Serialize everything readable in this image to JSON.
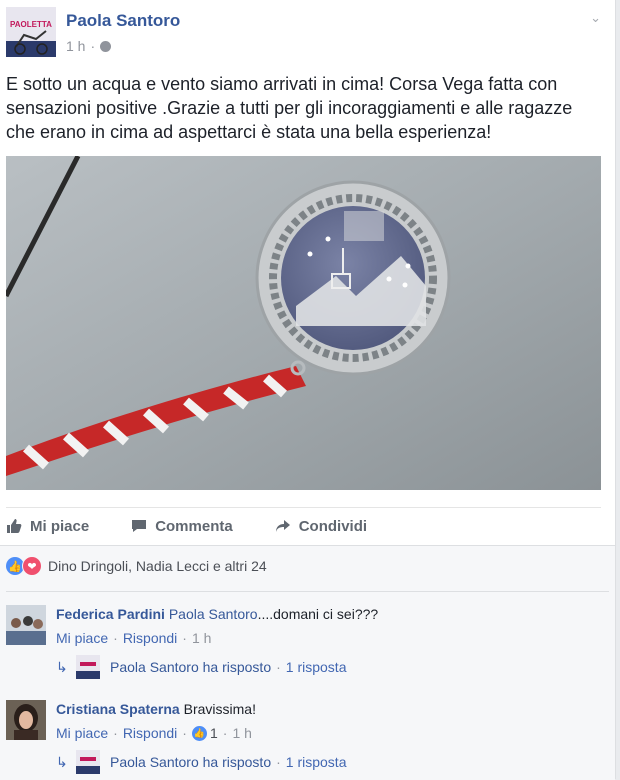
{
  "post": {
    "author": "Paola Santoro",
    "time": "1 h",
    "text": "E sotto un acqua e vento siamo arrivati in cima! Corsa Vega fatta con sensazioni positive .Grazie a tutti per gli incoraggiamenti e alle ragazze che erano in cima ad aspettarci è stata una bella esperienza!",
    "avatar_text": "PAOLETTA"
  },
  "actions": {
    "like": "Mi piace",
    "comment": "Commenta",
    "share": "Condividi"
  },
  "reactions": {
    "summary": "Dino Dringoli, Nadia Lecci e altri 24"
  },
  "comments": [
    {
      "name": "Federica Pardini",
      "mention": "Paola Santoro",
      "text": "....domani ci sei???",
      "like": "Mi piace",
      "reply": "Rispondi",
      "time": "1 h",
      "reply_author": "Paola Santoro ha risposto",
      "reply_count": "1 risposta"
    },
    {
      "name": "Cristiana Spaterna",
      "text": "Bravissima!",
      "like": "Mi piace",
      "reply": "Rispondi",
      "likes": "1",
      "time": "1 h",
      "reply_author": "Paola Santoro ha risposto",
      "reply_count": "1 risposta"
    }
  ],
  "colors": {
    "link": "#365899",
    "meta": "#90949c",
    "background": "#e9ebee",
    "like_blue": "#4e8ef7",
    "love_red": "#f0506e"
  }
}
